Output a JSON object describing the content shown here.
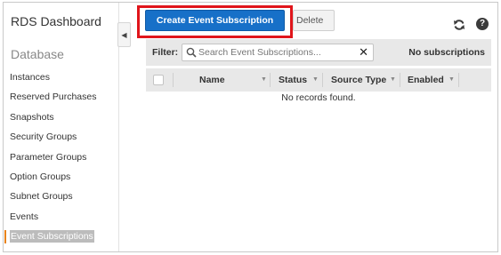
{
  "sidebar": {
    "title": "RDS Dashboard",
    "section": "Database",
    "items": [
      {
        "label": "Instances",
        "active": false
      },
      {
        "label": "Reserved Purchases",
        "active": false
      },
      {
        "label": "Snapshots",
        "active": false
      },
      {
        "label": "Security Groups",
        "active": false
      },
      {
        "label": "Parameter Groups",
        "active": false
      },
      {
        "label": "Option Groups",
        "active": false
      },
      {
        "label": "Subnet Groups",
        "active": false
      },
      {
        "label": "Events",
        "active": false
      },
      {
        "label": "Event Subscriptions",
        "active": true
      }
    ],
    "collapse_icon": "chevron-left-icon"
  },
  "toolbar": {
    "create_label": "Create Event Subscription",
    "delete_label": "Delete",
    "refresh_icon": "refresh-icon",
    "help_icon": "help-icon",
    "help_glyph": "?"
  },
  "filter": {
    "label": "Filter:",
    "placeholder": "Search Event Subscriptions...",
    "value": "",
    "clear_glyph": "✕",
    "count_text": "No subscriptions"
  },
  "table": {
    "columns": [
      "Name",
      "Status",
      "Source Type",
      "Enabled"
    ],
    "empty_text": "No records found."
  },
  "colors": {
    "primary_button": "#1770c8",
    "highlight_border": "#e0151b",
    "active_marker": "#e8831b"
  }
}
